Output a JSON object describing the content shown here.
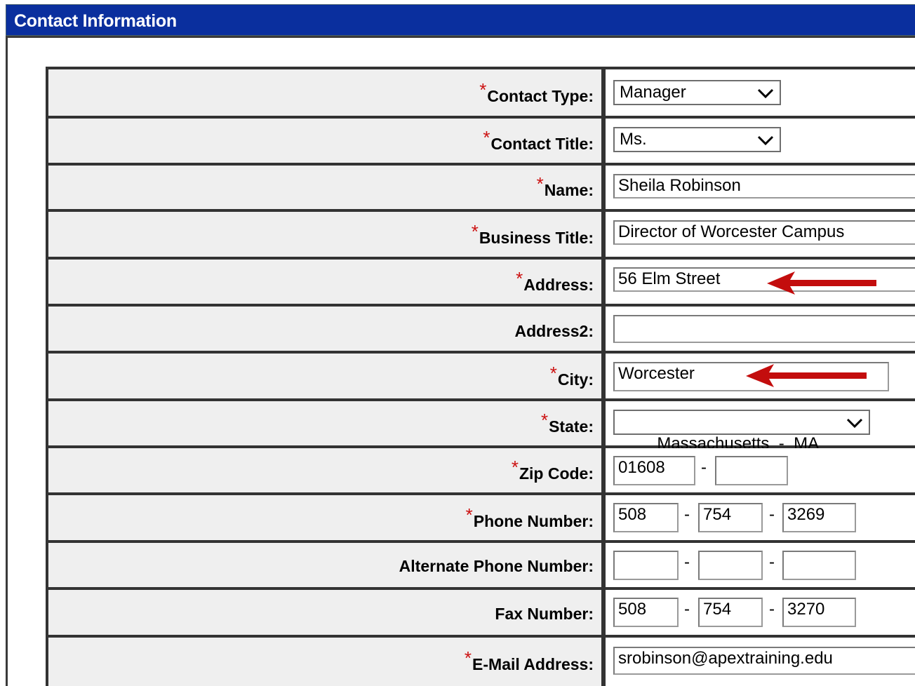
{
  "header": {
    "title": "Contact Information"
  },
  "form": {
    "contact_type": {
      "label": "Contact Type:",
      "value": "Manager",
      "required": "*"
    },
    "contact_title": {
      "label": "Contact Title:",
      "value": "Ms.",
      "required": "*"
    },
    "name": {
      "label": "Name:",
      "value": "Sheila Robinson",
      "required": "*"
    },
    "business_title": {
      "label": "Business Title:",
      "value": "Director of Worcester Campus",
      "required": "*"
    },
    "address": {
      "label": "Address:",
      "value": "56 Elm Street",
      "required": "*"
    },
    "address2": {
      "label": "Address2:",
      "value": ""
    },
    "city": {
      "label": "City:",
      "value": "Worcester",
      "required": "*"
    },
    "state": {
      "label": "State:",
      "value": "Massachusetts  -  MA",
      "required": "*"
    },
    "zip": {
      "label": "Zip Code:",
      "value": "01608",
      "ext": "",
      "required": "*",
      "sep": "-"
    },
    "phone": {
      "label": "Phone Number:",
      "area": "508",
      "prefix": "754",
      "line": "3269",
      "required": "*",
      "sep": "-"
    },
    "alt_phone": {
      "label": "Alternate Phone Number:",
      "area": "",
      "prefix": "",
      "line": "",
      "sep": "-"
    },
    "fax": {
      "label": "Fax Number:",
      "area": "508",
      "prefix": "754",
      "line": "3270",
      "sep": "-"
    },
    "email": {
      "label": "E-Mail Address:",
      "value": "srobinson@apextraining.edu",
      "required": "*"
    }
  },
  "annotations": {
    "arrow_color": "#c00000"
  },
  "colors": {
    "header_bg": "#0a2f9e",
    "label_bg": "#efefef",
    "required": "#cc1111"
  }
}
